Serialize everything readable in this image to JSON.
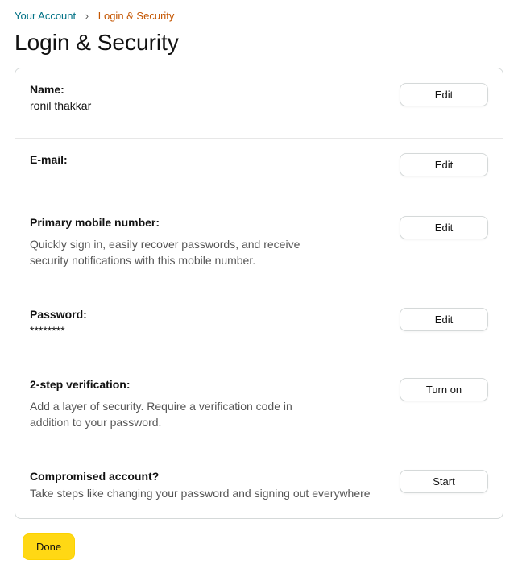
{
  "breadcrumb": {
    "root": "Your Account",
    "sep": "›",
    "current": "Login & Security"
  },
  "page_title": "Login & Security",
  "rows": {
    "name": {
      "label": "Name:",
      "value": "ronil thakkar",
      "button": "Edit"
    },
    "email": {
      "label": "E-mail:",
      "value": "",
      "button": "Edit"
    },
    "phone": {
      "label": "Primary mobile number:",
      "desc": "Quickly sign in, easily recover passwords, and receive security notifications with this mobile number.",
      "button": "Edit"
    },
    "password": {
      "label": "Password:",
      "value": "********",
      "button": "Edit"
    },
    "twostep": {
      "label": "2-step verification:",
      "desc": "Add a layer of security. Require a verification code in addition to your password.",
      "button": "Turn on"
    },
    "compromised": {
      "label": "Compromised account?",
      "desc": "Take steps like changing your password and signing out everywhere",
      "button": "Start"
    }
  },
  "done_button": "Done"
}
